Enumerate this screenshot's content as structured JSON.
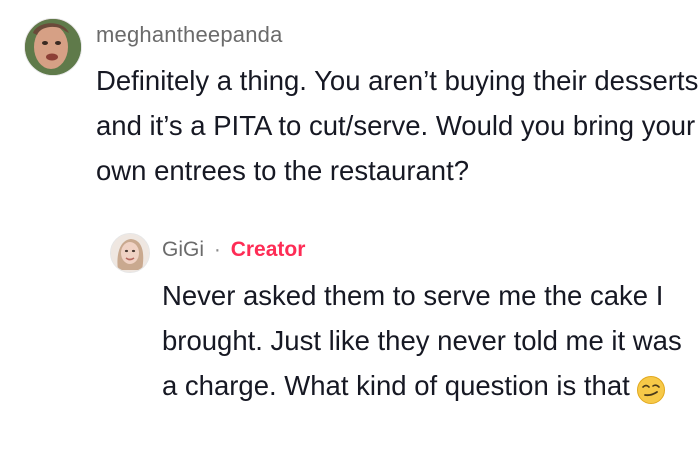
{
  "comment": {
    "username": "meghantheepanda",
    "text": "Definitely a thing. You aren’t buying their desserts and it’s a PITA to cut/serve. Would you bring your own entrees to the restaurant?"
  },
  "reply": {
    "username": "GiGi",
    "separator": "·",
    "badge": "Creator",
    "text": "Never asked them to serve me the cake I brought. Just like they never told me it was a charge. What kind of question is that"
  },
  "icons": {
    "emoji": "smirk-emoji-icon",
    "comment_avatar": "avatar-icon",
    "reply_avatar": "avatar-icon"
  },
  "colors": {
    "creator_badge": "#fe2c55",
    "username": "#6b6b6b",
    "text": "#161823"
  }
}
